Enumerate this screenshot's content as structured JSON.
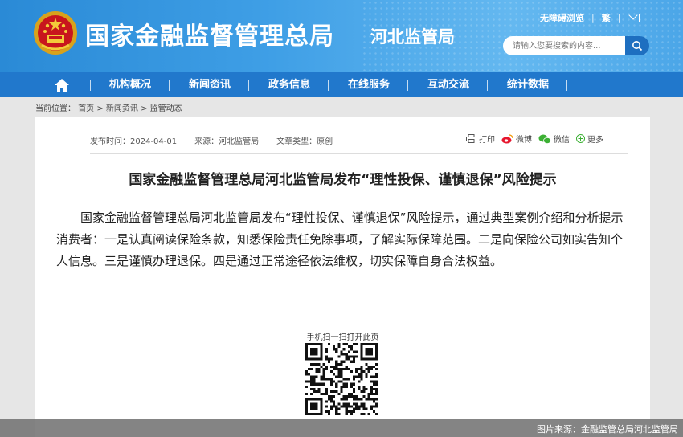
{
  "header": {
    "site_title": "国家金融监督管理总局",
    "sub_title": "河北监管局",
    "accessibility_label": "无障碍浏览",
    "traditional_label": "繁",
    "search_placeholder": "请输入您要搜索的内容...",
    "colors": {
      "header_blue": "#3f9fe6",
      "nav_blue": "#2178cc"
    }
  },
  "nav": {
    "items": [
      "机构概况",
      "新闻资讯",
      "政务信息",
      "在线服务",
      "互动交流",
      "统计数据"
    ]
  },
  "breadcrumb": {
    "prefix": "当前位置：",
    "path": "首页 > 新闻资讯 > 监管动态"
  },
  "article": {
    "publish_time": "发布时间：2024-04-01",
    "source": "来源：河北监管局",
    "type": "文章类型：原创",
    "share": {
      "print": "打印",
      "weibo": "微博",
      "wechat": "微信",
      "more": "更多"
    },
    "title": "国家金融监督管理总局河北监管局发布“理性投保、谨慎退保”风险提示",
    "body": "国家金融监督管理总局河北监管局发布“理性投保、谨慎退保”风险提示，通过典型案例介绍和分析提示消费者：一是认真阅读保险条款，知悉保险责任免除事项，了解实际保障范围。二是向保险公司如实告知个人信息。三是谨慎办理退保。四是通过正常途径依法维权，切实保障自身合法权益。",
    "qr_label": "手机扫一扫打开此页"
  },
  "credit": "图片来源：金融监管总局河北监管局"
}
